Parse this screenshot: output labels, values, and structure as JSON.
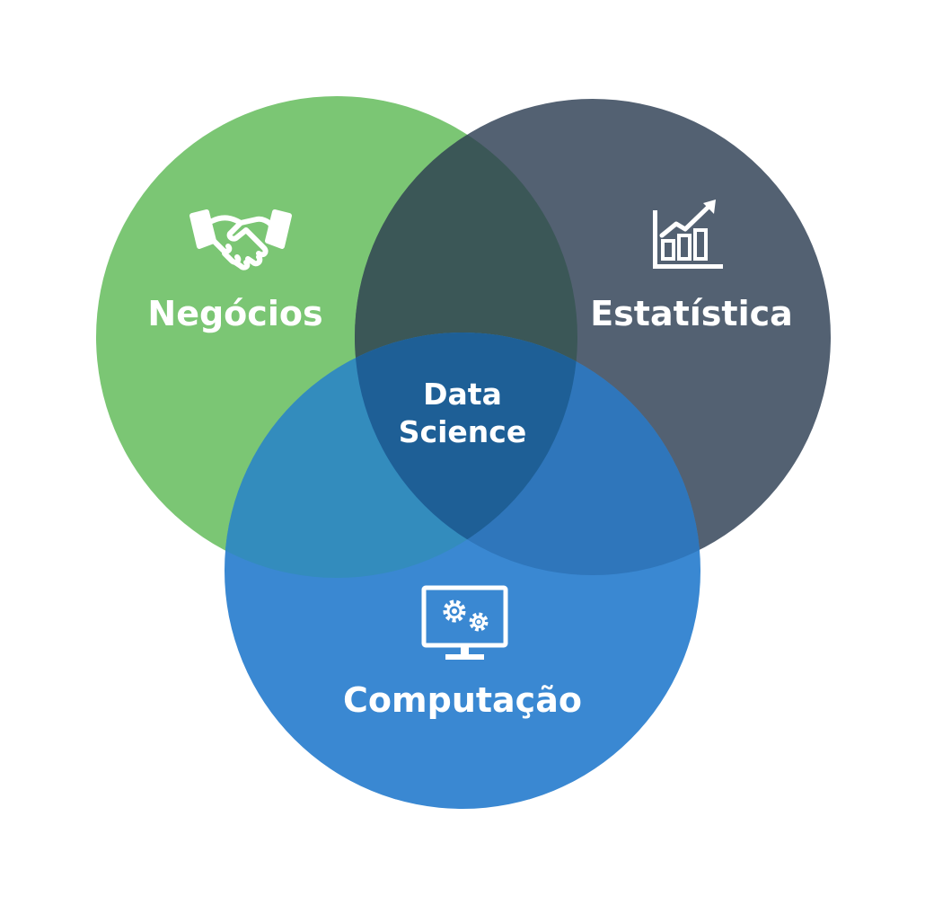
{
  "circles": {
    "business": {
      "label": "Negócios",
      "color": "#7bc674",
      "icon": "handshake-icon"
    },
    "statistics": {
      "label": "Estatística",
      "color": "#536172",
      "icon": "bar-chart-growth-icon"
    },
    "computing": {
      "label": "Computação",
      "color": "#3a88d2",
      "icon": "monitor-gears-icon"
    }
  },
  "overlaps": {
    "business_statistics": {
      "color": "#3b5757"
    },
    "business_computing": {
      "color": "#338cbd"
    },
    "statistics_computing": {
      "color": "#2f76bb"
    }
  },
  "center": {
    "line1": "Data",
    "line2": "Science",
    "color": "#1e5f96"
  },
  "icon_color": "#ffffff"
}
